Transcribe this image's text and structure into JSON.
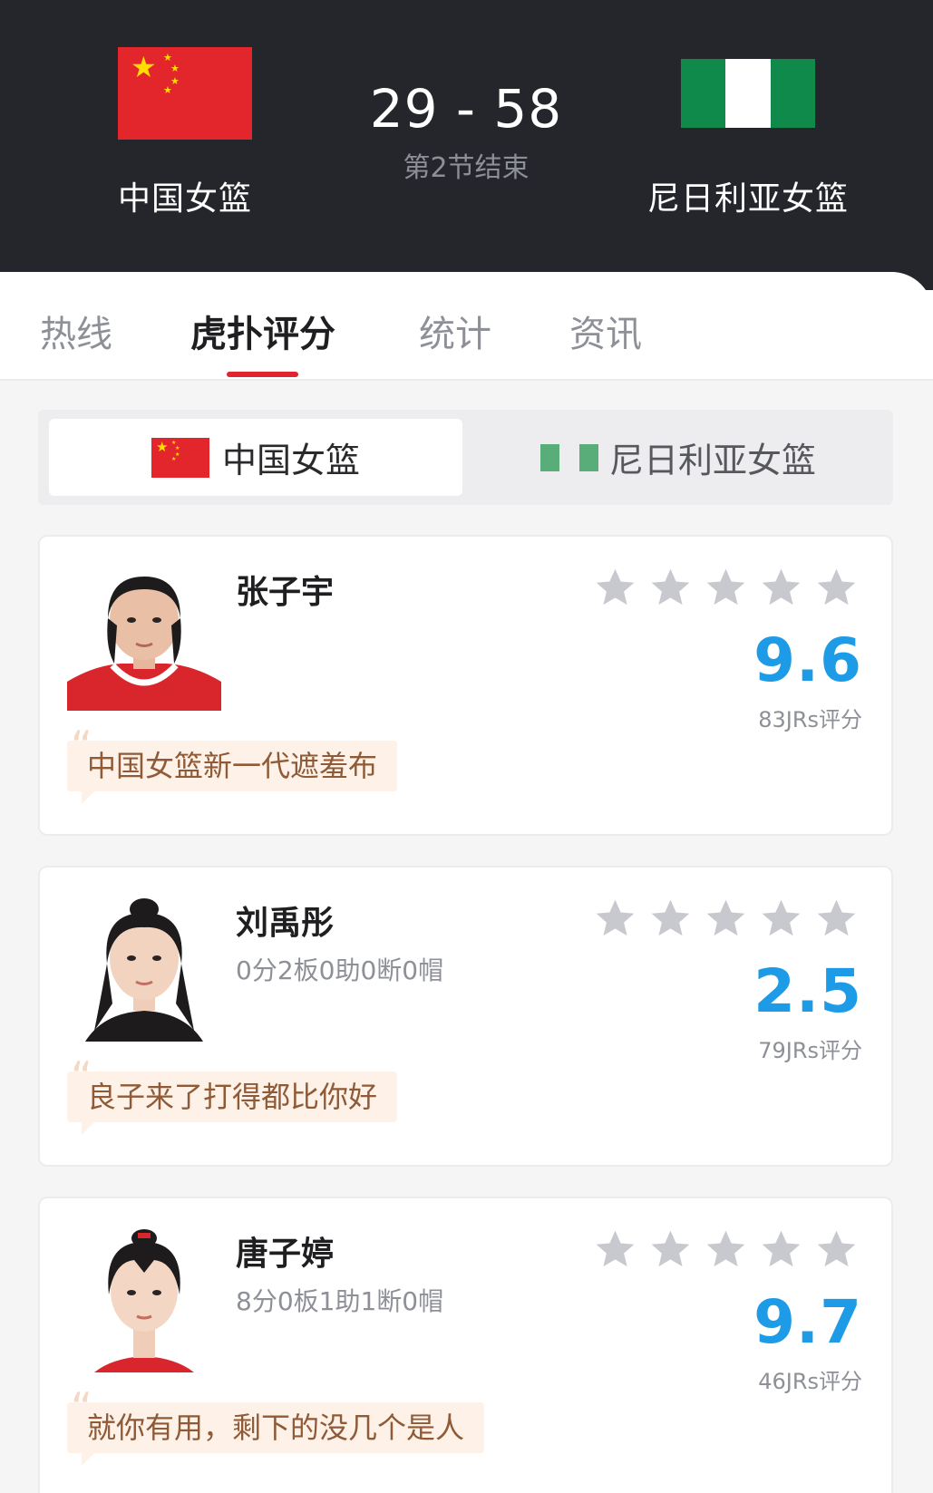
{
  "match": {
    "home_team": "中国女篮",
    "away_team": "尼日利亚女篮",
    "score": "29 - 58",
    "period": "第2节结束",
    "home_flag": "china-flag-icon",
    "away_flag": "nigeria-flag-icon"
  },
  "tabs": [
    {
      "label": "热线",
      "active": false
    },
    {
      "label": "虎扑评分",
      "active": true
    },
    {
      "label": "统计",
      "active": false
    },
    {
      "label": "资讯",
      "active": false
    }
  ],
  "team_switch": {
    "home": "中国女篮",
    "away": "尼日利亚女篮",
    "selected": "home"
  },
  "players": [
    {
      "name": "张子宇",
      "stats": "",
      "rating": "9.6",
      "votes": "83JRs评分",
      "comment": "中国女篮新一代遮羞布"
    },
    {
      "name": "刘禹彤",
      "stats": "0分2板0助0断0帽",
      "rating": "2.5",
      "votes": "79JRs评分",
      "comment": "良子来了打得都比你好"
    },
    {
      "name": "唐子婷",
      "stats": "8分0板1助1断0帽",
      "rating": "9.7",
      "votes": "46JRs评分",
      "comment": "就你有用，剩下的没几个是人"
    }
  ],
  "colors": {
    "header_bg": "#25262b",
    "accent_red": "#e02531",
    "rating_blue": "#1e9be6",
    "star_gray": "#c8c9ce",
    "quote_bg": "#fdf1e8",
    "quote_text": "#8f5a35"
  }
}
